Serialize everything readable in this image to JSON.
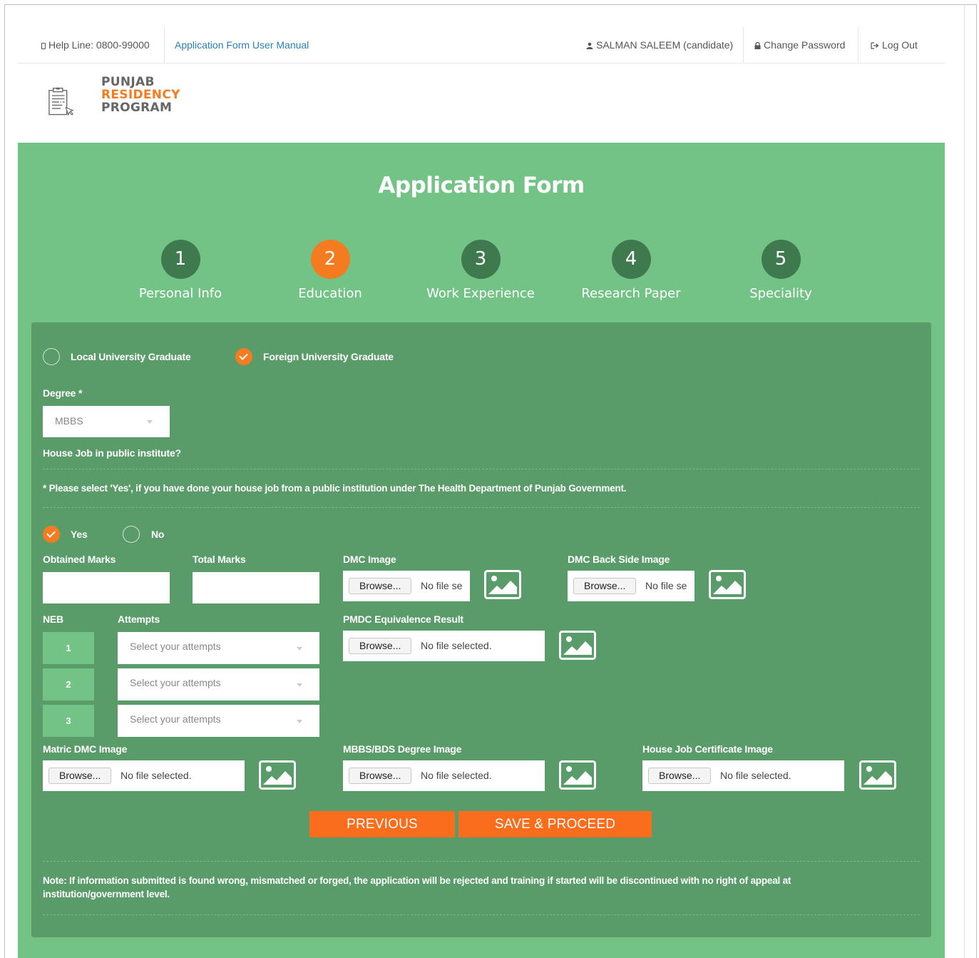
{
  "topbar": {
    "helpline": "Help Line: 0800-99000",
    "manual_link": "Application Form User Manual",
    "user": "SALMAN SALEEM (candidate)",
    "change_password": "Change Password",
    "logout": "Log Out"
  },
  "logo": {
    "line1": "PUNJAB",
    "line2": "RESIDENCY",
    "line3": "PROGRAM"
  },
  "form": {
    "title": "Application Form"
  },
  "steps": [
    {
      "number": "1",
      "label": "Personal Info"
    },
    {
      "number": "2",
      "label": "Education"
    },
    {
      "number": "3",
      "label": "Work Experience"
    },
    {
      "number": "4",
      "label": "Research Paper"
    },
    {
      "number": "5",
      "label": "Speciality"
    }
  ],
  "active_step": 2,
  "graduate_type": {
    "local_label": "Local University Graduate",
    "foreign_label": "Foreign University Graduate",
    "selected": "foreign"
  },
  "degree": {
    "label": "Degree *",
    "value": "MBBS"
  },
  "house_job": {
    "question": "House Job in public institute?",
    "hint": "* Please select 'Yes', if you have done your house job from a public institution under The Health Department of Punjab Government.",
    "yes_label": "Yes",
    "no_label": "No",
    "selected": "yes"
  },
  "marks": {
    "obtained_label": "Obtained Marks",
    "total_label": "Total Marks",
    "obtained_value": "",
    "total_value": ""
  },
  "uploads": {
    "browse_label": "Browse...",
    "dmc_label": "DMC Image",
    "dmc_back_label": "DMC Back Side Image",
    "pmdc_label": "PMDC Equivalence Result",
    "matric_label": "Matric DMC Image",
    "degree_label": "MBBS/BDS Degree Image",
    "housejob_cert_label": "House Job Certificate Image",
    "no_file_short": "No file se",
    "no_file": "No file selected."
  },
  "neb": {
    "neb_label": "NEB",
    "attempts_label": "Attempts",
    "rows": [
      {
        "number": "1",
        "placeholder": "Select your attempts"
      },
      {
        "number": "2",
        "placeholder": "Select your attempts"
      },
      {
        "number": "3",
        "placeholder": "Select your attempts"
      }
    ]
  },
  "buttons": {
    "previous": "PREVIOUS",
    "save": "SAVE & PROCEED"
  },
  "note": "Note: If information submitted is found wrong, mismatched or forged, the application will be rejected and training if started will be discontinued with no right of appeal at institution/government level.",
  "colors": {
    "accent": "#f47b20",
    "green_bg": "#73c386",
    "panel_bg": "#5a9c69",
    "step_circle": "#3f7a4f",
    "link": "#2a7fbd"
  },
  "icons": [
    "phone-icon",
    "user-icon",
    "lock-icon",
    "logout-icon",
    "image-icon",
    "checkmark-icon",
    "chevron-down-icon"
  ]
}
